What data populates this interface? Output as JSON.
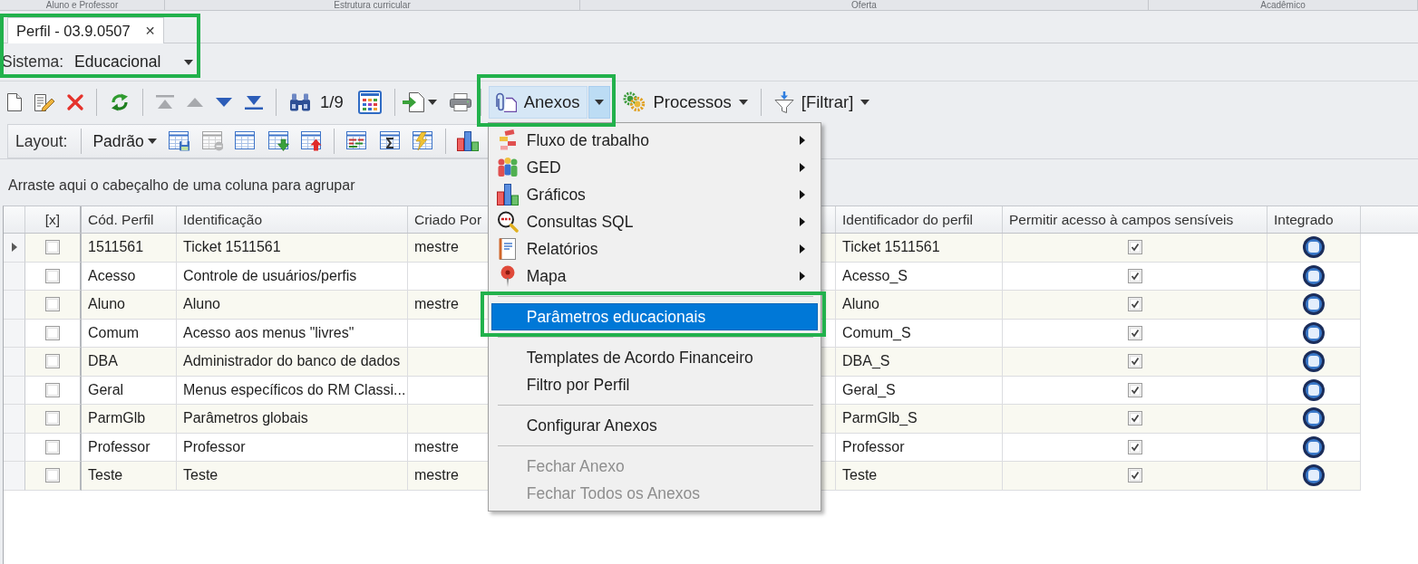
{
  "ribbon": {
    "groups": [
      "Aluno e Professor",
      "Estrutura curricular",
      "Oferta",
      "Acadêmico"
    ]
  },
  "document": {
    "highlighted": true,
    "tabs": [
      {
        "label": "Perfil - 03.9.0507",
        "selected": true,
        "close": "✕"
      }
    ],
    "system": {
      "label": "Sistema:",
      "value": "Educacional"
    }
  },
  "toolbar": {
    "navigation": [
      {
        "disabled": true
      },
      {
        "disabled": true
      },
      {
        "disabled": false
      },
      {
        "disabled": false
      }
    ],
    "counter": "1/9",
    "attachments": {
      "label": "Anexos",
      "expanded": true,
      "highlighted": true
    },
    "processes": {
      "label": "Processos"
    },
    "filter": {
      "label": "[Filtrar]"
    }
  },
  "layout_bar": {
    "label": "Layout:",
    "preset": "Padrão",
    "tools": [
      {
        "disabled": false
      },
      {
        "disabled": true
      },
      {
        "disabled": false
      },
      {
        "disabled": false
      },
      {
        "disabled": false
      },
      {
        "disabled": false
      },
      {
        "disabled": false
      },
      {
        "disabled": false
      },
      {
        "disabled": false
      }
    ]
  },
  "group_panel": {
    "hint": "Arraste aqui o cabeçalho de uma coluna para agrupar"
  },
  "table": {
    "columns": [
      {
        "label": "[x]",
        "kind": "checkbox"
      },
      {
        "label": "Cód. Perfil",
        "kind": "text"
      },
      {
        "label": "Identificação",
        "kind": "text"
      },
      {
        "label": "Criado Por",
        "kind": "text"
      },
      {
        "label": "Identificador do perfil",
        "kind": "text"
      },
      {
        "label": "Permitir acesso à campos sensíveis",
        "kind": "checkbox"
      },
      {
        "label": "Integrado",
        "kind": "icon"
      }
    ],
    "rows": [
      {
        "selected": true,
        "cells": [
          {
            "checked": false
          },
          {
            "text": "1511561"
          },
          {
            "text": "Ticket 1511561"
          },
          {
            "text": "mestre"
          },
          {
            "text": "Ticket 1511561"
          },
          {
            "checked": true
          },
          {
            "integrated": true
          }
        ]
      },
      {
        "selected": false,
        "cells": [
          {
            "checked": false
          },
          {
            "text": "Acesso"
          },
          {
            "text": "Controle de usuários/perfis"
          },
          {},
          {
            "text": "Acesso_S"
          },
          {
            "checked": true
          },
          {
            "integrated": true
          }
        ]
      },
      {
        "selected": false,
        "cells": [
          {
            "checked": false
          },
          {
            "text": "Aluno"
          },
          {
            "text": "Aluno"
          },
          {
            "text": "mestre"
          },
          {
            "text": "Aluno"
          },
          {
            "checked": true
          },
          {
            "integrated": true
          }
        ]
      },
      {
        "selected": false,
        "cells": [
          {
            "checked": false
          },
          {
            "text": "Comum"
          },
          {
            "text": "Acesso aos menus \"livres\""
          },
          {},
          {
            "text": "Comum_S"
          },
          {
            "checked": true
          },
          {
            "integrated": true
          }
        ]
      },
      {
        "selected": false,
        "cells": [
          {
            "checked": false
          },
          {
            "text": "DBA"
          },
          {
            "text": "Administrador do banco de dados"
          },
          {},
          {
            "text": "DBA_S"
          },
          {
            "checked": true
          },
          {
            "integrated": true
          }
        ]
      },
      {
        "selected": false,
        "cells": [
          {
            "checked": false
          },
          {
            "text": "Geral"
          },
          {
            "text": "Menus específicos do RM Classi..."
          },
          {},
          {
            "text": "Geral_S"
          },
          {
            "checked": true
          },
          {
            "integrated": true
          }
        ]
      },
      {
        "selected": false,
        "cells": [
          {
            "checked": false
          },
          {
            "text": "ParmGlb"
          },
          {
            "text": "Parâmetros globais"
          },
          {},
          {
            "text": "ParmGlb_S"
          },
          {
            "checked": true
          },
          {
            "integrated": true
          }
        ]
      },
      {
        "selected": false,
        "cells": [
          {
            "checked": false
          },
          {
            "text": "Professor"
          },
          {
            "text": "Professor"
          },
          {
            "text": "mestre"
          },
          {
            "text": "Professor"
          },
          {
            "checked": true
          },
          {
            "integrated": true
          }
        ]
      },
      {
        "selected": false,
        "cells": [
          {
            "checked": false
          },
          {
            "text": "Teste"
          },
          {
            "text": "Teste"
          },
          {
            "text": "mestre"
          },
          {
            "text": "Teste"
          },
          {
            "checked": true
          },
          {
            "integrated": true
          }
        ]
      }
    ]
  },
  "menu": {
    "items": [
      {
        "kind": "item",
        "label": "Fluxo de trabalho",
        "submenu": true,
        "selected": false,
        "disabled": false
      },
      {
        "kind": "item",
        "label": "GED",
        "submenu": true,
        "selected": false,
        "disabled": false
      },
      {
        "kind": "item",
        "label": "Gráficos",
        "submenu": true,
        "selected": false,
        "disabled": false
      },
      {
        "kind": "item",
        "label": "Consultas SQL",
        "submenu": true,
        "selected": false,
        "disabled": false
      },
      {
        "kind": "item",
        "label": "Relatórios",
        "submenu": true,
        "selected": false,
        "disabled": false
      },
      {
        "kind": "item",
        "label": "Mapa",
        "submenu": true,
        "selected": false,
        "disabled": false
      },
      {
        "kind": "separator"
      },
      {
        "kind": "item",
        "label": "Parâmetros educacionais",
        "submenu": false,
        "selected": true,
        "disabled": false,
        "highlighted": true
      },
      {
        "kind": "separator"
      },
      {
        "kind": "item",
        "label": "Templates de Acordo Financeiro",
        "submenu": false,
        "selected": false,
        "disabled": false
      },
      {
        "kind": "item",
        "label": "Filtro por Perfil",
        "submenu": false,
        "selected": false,
        "disabled": false
      },
      {
        "kind": "separator"
      },
      {
        "kind": "item",
        "label": "Configurar Anexos",
        "submenu": false,
        "selected": false,
        "disabled": false
      },
      {
        "kind": "separator"
      },
      {
        "kind": "item",
        "label": "Fechar Anexo",
        "submenu": false,
        "selected": false,
        "disabled": true
      },
      {
        "kind": "item",
        "label": "Fechar Todos os Anexos",
        "submenu": false,
        "selected": false,
        "disabled": true
      }
    ]
  }
}
